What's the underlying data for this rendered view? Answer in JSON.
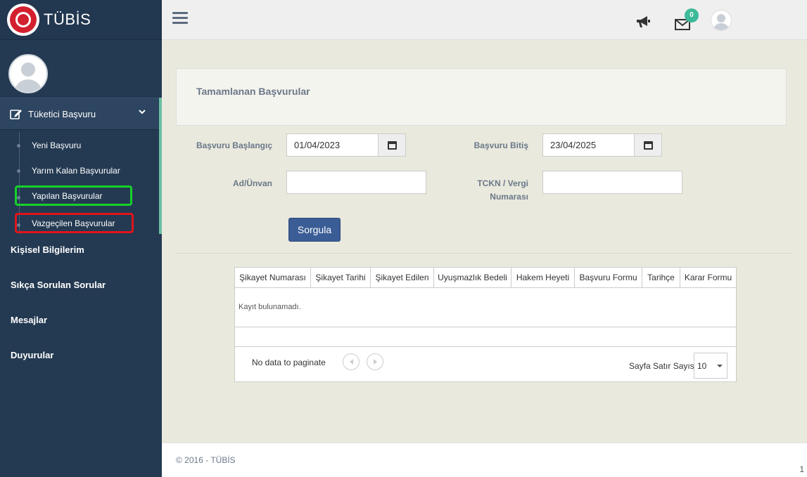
{
  "brand": {
    "name": "TÜBİS"
  },
  "sidebar": {
    "active_menu": {
      "label": "Tüketici Başvuru"
    },
    "submenu": [
      {
        "label": "Yeni Başvuru"
      },
      {
        "label": "Yarım Kalan Başvurular"
      },
      {
        "label": "Yapılan Başvurular"
      },
      {
        "label": "Vazgeçilen Başvurular"
      }
    ],
    "items": [
      {
        "label": "Kişisel Bilgilerim"
      },
      {
        "label": "Sıkça Sorulan Sorular"
      },
      {
        "label": "Mesajlar"
      },
      {
        "label": "Duyurular"
      }
    ]
  },
  "header": {
    "message_count": "0",
    "icons": [
      "menu-icon",
      "megaphone-icon",
      "envelope-icon",
      "user-avatar"
    ]
  },
  "page": {
    "title": "Tamamlanan Başvurular"
  },
  "form": {
    "start_label": "Başvuru Başlangıç",
    "start_value": "01/04/2023",
    "end_label": "Başvuru Bitiş",
    "end_value": "23/04/2025",
    "name_label": "Ad/Ünvan",
    "name_value": "",
    "tckn_label_1": "TCKN / Vergi",
    "tckn_label_2": "Numarası",
    "tckn_value": "",
    "submit_label": "Sorgula"
  },
  "table": {
    "columns": [
      "Şikayet Numarası",
      "Şikayet Tarihi",
      "Şikayet Edilen",
      "Uyuşmazlık Bedeli",
      "Hakem Heyeti",
      "Başvuru Formu",
      "Tarihçe",
      "Karar Formu"
    ],
    "empty_text": "Kayıt bulunamadı.",
    "pager_text": "No data to paginate",
    "rows_label": "Sayfa Satır Sayısı",
    "rows_value": "10"
  },
  "footer": {
    "copyright": "© 2016 - TÜBİS",
    "page_number": "1"
  },
  "colors": {
    "sidebar": "#243a52",
    "accent": "#6bbfa3",
    "primary_button": "#3b5d96",
    "highlight_green": "#16d12a",
    "highlight_red": "#e0141c"
  }
}
